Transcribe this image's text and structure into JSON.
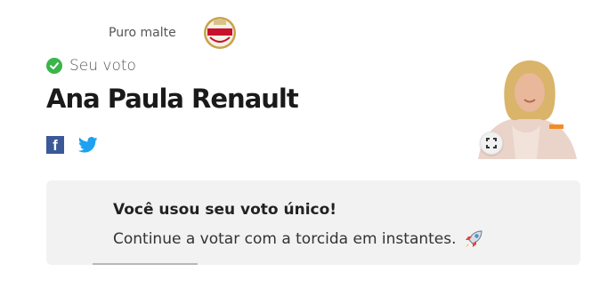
{
  "sponsor": {
    "text": "Puro malte",
    "logo_icon": "amstel-logo-icon"
  },
  "vote_status": {
    "label": "Seu voto",
    "icon": "check-circle-icon",
    "color": "#3bb54a"
  },
  "candidate": {
    "name": "Ana Paula Renault",
    "photo_icon": "candidate-photo",
    "expand_icon": "expand-icon"
  },
  "share": {
    "facebook_icon": "facebook-icon",
    "twitter_icon": "twitter-icon"
  },
  "notice": {
    "title": "Você usou seu voto único!",
    "body": "Continue a votar com a torcida em instantes.",
    "icon": "rocket-icon"
  }
}
